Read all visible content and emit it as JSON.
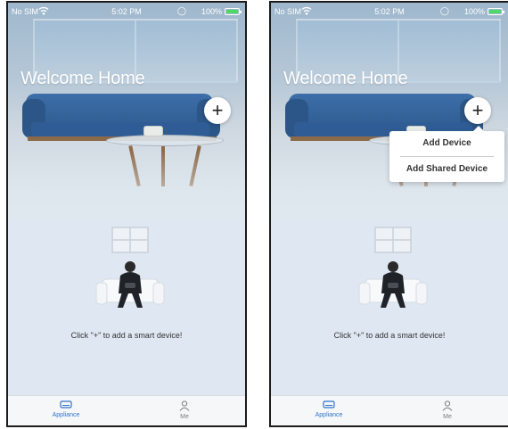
{
  "screens": [
    {
      "status": {
        "carrier": "No SIM",
        "time": "5:02 PM",
        "battery": "100%"
      },
      "title": "Welcome Home",
      "add_button": "+",
      "empty_message": "Click \"+\" to add a smart device!",
      "tabs": [
        {
          "label": "Appliance",
          "icon": "appliance-icon",
          "active": true
        },
        {
          "label": "Me",
          "icon": "person-icon",
          "active": false
        }
      ]
    },
    {
      "status": {
        "carrier": "No SIM",
        "time": "5:02 PM",
        "battery": "100%"
      },
      "title": "Welcome Home",
      "add_button": "+",
      "menu": [
        "Add Device",
        "Add Shared Device"
      ],
      "empty_message": "Click \"+\" to add a smart device!",
      "tabs": [
        {
          "label": "Appliance",
          "icon": "appliance-icon",
          "active": true
        },
        {
          "label": "Me",
          "icon": "person-icon",
          "active": false
        }
      ]
    }
  ],
  "colors": {
    "accent": "#2f73c9",
    "battery": "#4cd964",
    "sofa": "#2f5c94"
  }
}
